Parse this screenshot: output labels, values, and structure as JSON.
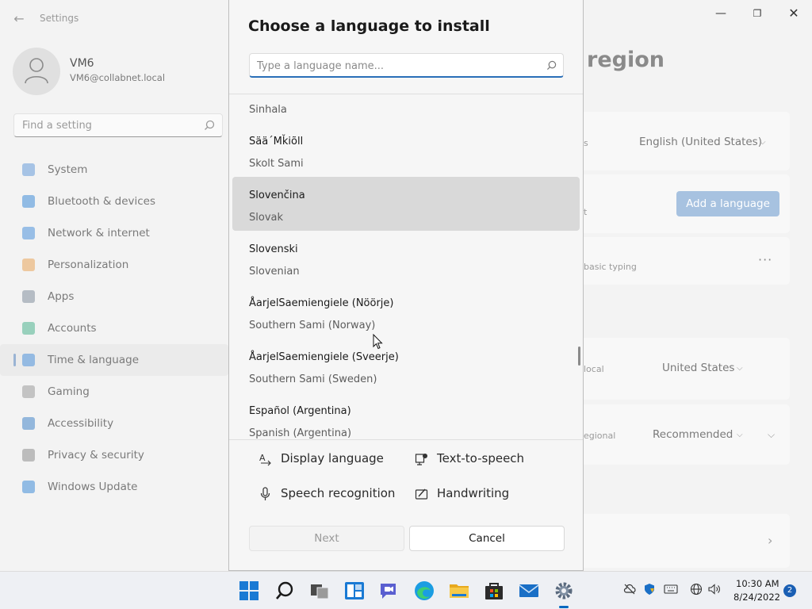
{
  "settings": {
    "window_title": "Settings",
    "user": {
      "name": "VM6",
      "email": "VM6@collabnet.local"
    },
    "find_placeholder": "Find a setting",
    "nav": [
      {
        "label": "System",
        "icon": "monitor-icon",
        "color": "#4a8ad4"
      },
      {
        "label": "Bluetooth & devices",
        "icon": "bluetooth-icon",
        "color": "#1a78d2"
      },
      {
        "label": "Network & internet",
        "icon": "wifi-icon",
        "color": "#2b7fd6"
      },
      {
        "label": "Personalization",
        "icon": "brush-icon",
        "color": "#e6943a"
      },
      {
        "label": "Apps",
        "icon": "apps-icon",
        "color": "#6a7a8c"
      },
      {
        "label": "Accounts",
        "icon": "person-icon",
        "color": "#2aa77a"
      },
      {
        "label": "Time & language",
        "icon": "clock-globe-icon",
        "color": "#2b7fd6"
      },
      {
        "label": "Gaming",
        "icon": "gamepad-icon",
        "color": "#8a8a8a"
      },
      {
        "label": "Accessibility",
        "icon": "accessibility-icon",
        "color": "#1f6fc2"
      },
      {
        "label": "Privacy & security",
        "icon": "shield-icon",
        "color": "#7a7a7a"
      },
      {
        "label": "Windows Update",
        "icon": "update-icon",
        "color": "#1a78d2"
      }
    ],
    "active_nav": "Time & language",
    "page_title_fragment": "region",
    "rows": {
      "display_fragment": "s",
      "display_value": "English (United States)",
      "preferred_fragment": "t",
      "add_language_label": "Add a language",
      "typing_fragment": "basic typing",
      "country_fragment": "local",
      "country_value": "United States",
      "format_fragment": "egional",
      "format_value": "Recommended"
    }
  },
  "dialog": {
    "title": "Choose a language to install",
    "search_placeholder": "Type a language name...",
    "languages": [
      {
        "native": "",
        "english": "Sinhala"
      },
      {
        "native": "Sää´Mǩiõll",
        "english": "Skolt Sami"
      },
      {
        "native": "Slovenčina",
        "english": "Slovak",
        "selected": true
      },
      {
        "native": "Slovenski",
        "english": "Slovenian"
      },
      {
        "native": "ÅarjelSaemiengiele (Nöörje)",
        "english": "Southern Sami (Norway)"
      },
      {
        "native": "ÅarjelSaemiengiele (Sveerje)",
        "english": "Southern Sami (Sweden)"
      },
      {
        "native": "Español (Argentina)",
        "english": "Spanish (Argentina)"
      }
    ],
    "features": {
      "display_language": "Display language",
      "text_to_speech": "Text-to-speech",
      "speech_recognition": "Speech recognition",
      "handwriting": "Handwriting"
    },
    "buttons": {
      "next": "Next",
      "cancel": "Cancel"
    }
  },
  "taskbar": {
    "apps": [
      "start",
      "search",
      "task-view",
      "widgets",
      "chat",
      "edge",
      "file-explorer",
      "store",
      "mail",
      "settings"
    ],
    "active_app": "settings",
    "time": "10:30 AM",
    "date": "8/24/2022",
    "notification_count": "2"
  }
}
